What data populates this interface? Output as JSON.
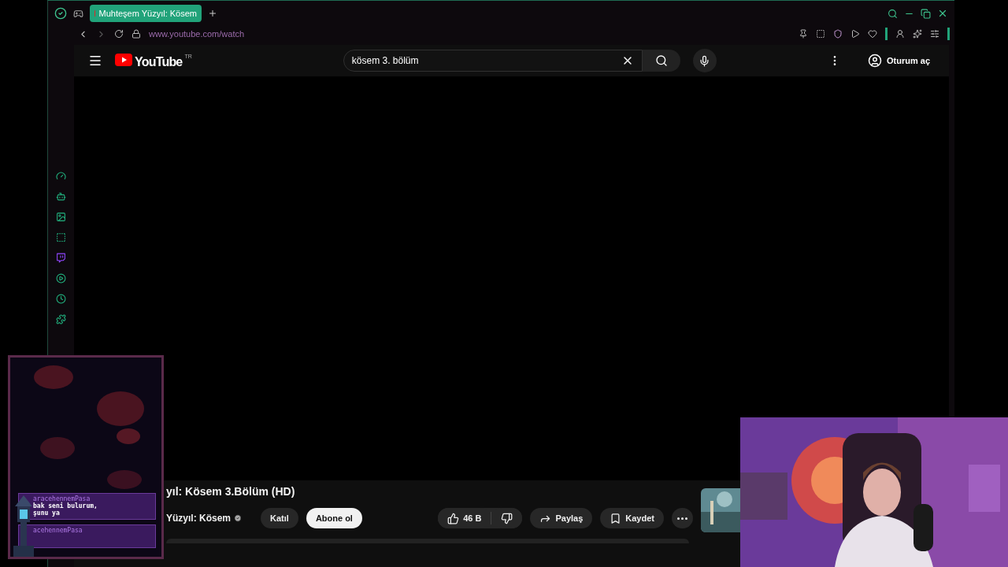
{
  "browser": {
    "tab": {
      "title": "Muhteşem Yüzyıl: Kösem",
      "selected": true
    },
    "address": "www.youtube.com/watch"
  },
  "youtube": {
    "logo": "YouTube",
    "region": "TR",
    "search": {
      "value": "kösem 3. bölüm"
    },
    "sign_in": "Oturum aç",
    "video": {
      "title": "yıl: Kösem 3.Bölüm (HD)",
      "channel": "Yüzyıl: Kösem",
      "verified": true,
      "join": "Katıl",
      "subscribe": "Abone ol",
      "likes": "46 B",
      "share": "Paylaş",
      "save": "Kaydet"
    }
  },
  "chat": {
    "messages": [
      {
        "user": "aracehennemPasa",
        "text": "bak seni bulurum,\nşunu ya"
      },
      {
        "user": "acehennemPasa"
      }
    ]
  }
}
